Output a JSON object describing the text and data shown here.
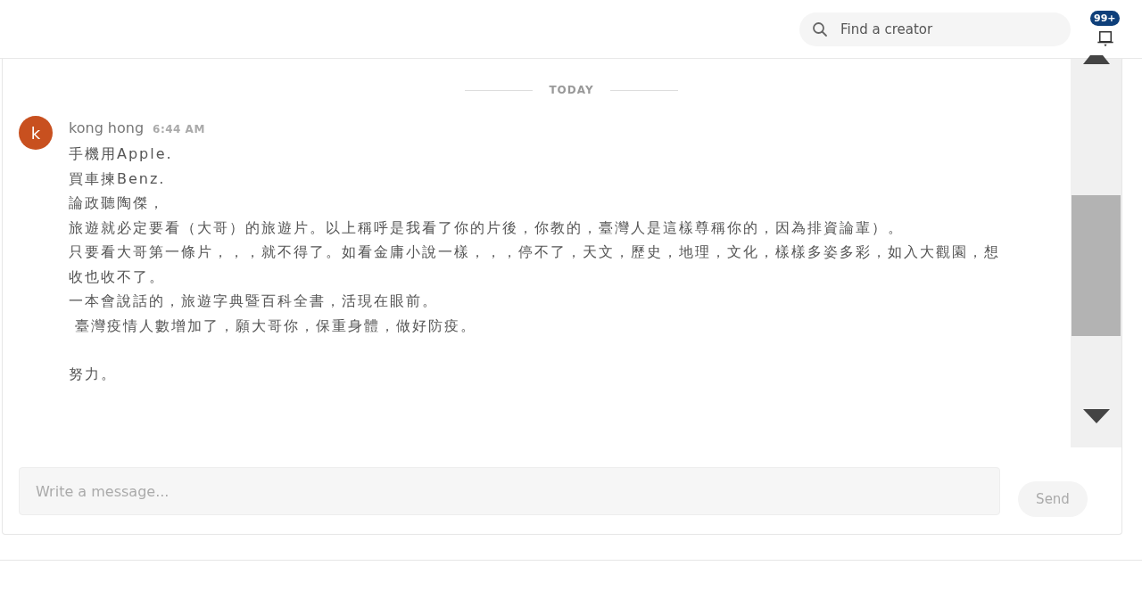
{
  "header": {
    "search": {
      "placeholder": "Find a creator"
    },
    "notifications": {
      "badge": "99+"
    }
  },
  "chat": {
    "date_divider": "TODAY",
    "messages": [
      {
        "author": "kong hong",
        "avatar_letter": "k",
        "time": "6:44 AM",
        "paragraphs": [
          [
            "手機用Apple.",
            "買車揀Benz.",
            "論政聽陶傑，",
            "旅遊就必定要看（大哥）的旅遊片。以上稱呼是我看了你的片後，你教的，臺灣人是這樣尊稱你的，因為排資論輩）。",
            "只要看大哥第一條片，，，就不得了。如看金庸小說一樣，，，停不了，天文，歷史，地理，文化，樣樣多姿多彩，如入大觀園，想收也收不了。",
            "一本會說話的，旅遊字典暨百科全書，活現在眼前。",
            " 臺灣疫情人數增加了，願大哥你，保重身體，做好防疫。"
          ],
          [
            "努力。"
          ]
        ]
      }
    ],
    "composer": {
      "placeholder": "Write a message...",
      "send_button": "Send"
    }
  }
}
